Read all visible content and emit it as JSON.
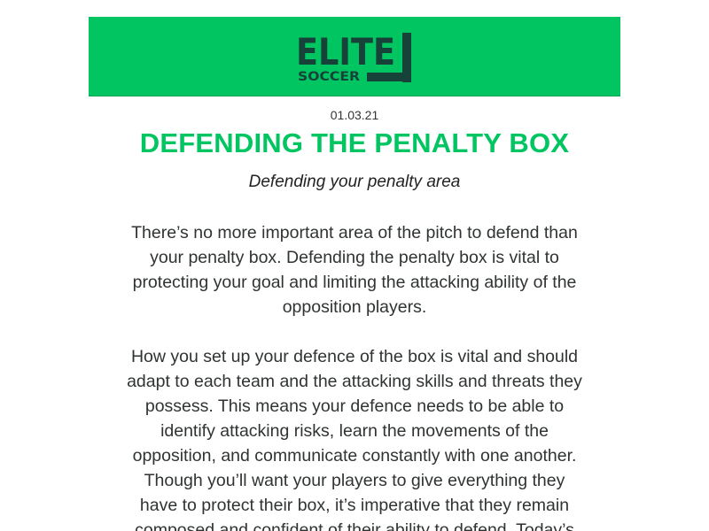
{
  "header": {
    "logo_line1": "ELITE",
    "logo_line2": "SOCCER",
    "brand_color": "#00c561",
    "logo_color": "#16423a"
  },
  "article": {
    "date": "01.03.21",
    "title": "DEFENDING THE PENALTY BOX",
    "subtitle": "Defending your penalty area",
    "paragraphs": [
      "There’s no more important area of the pitch to defend than your penalty box. Defending the penalty box is vital to protecting your goal and limiting the attacking ability of the opposition players.",
      "How you set up your defence of the box is vital and should adapt to each team and the attacking skills and threats they possess. This means your defence needs to be able to identify attacking risks, learn the movements of the opposition, and communicate constantly with one another. Though you’ll want your players to give everything they have to protect their box, it’s imperative that they remain composed and confident of their ability to defend. Today’s"
    ]
  }
}
